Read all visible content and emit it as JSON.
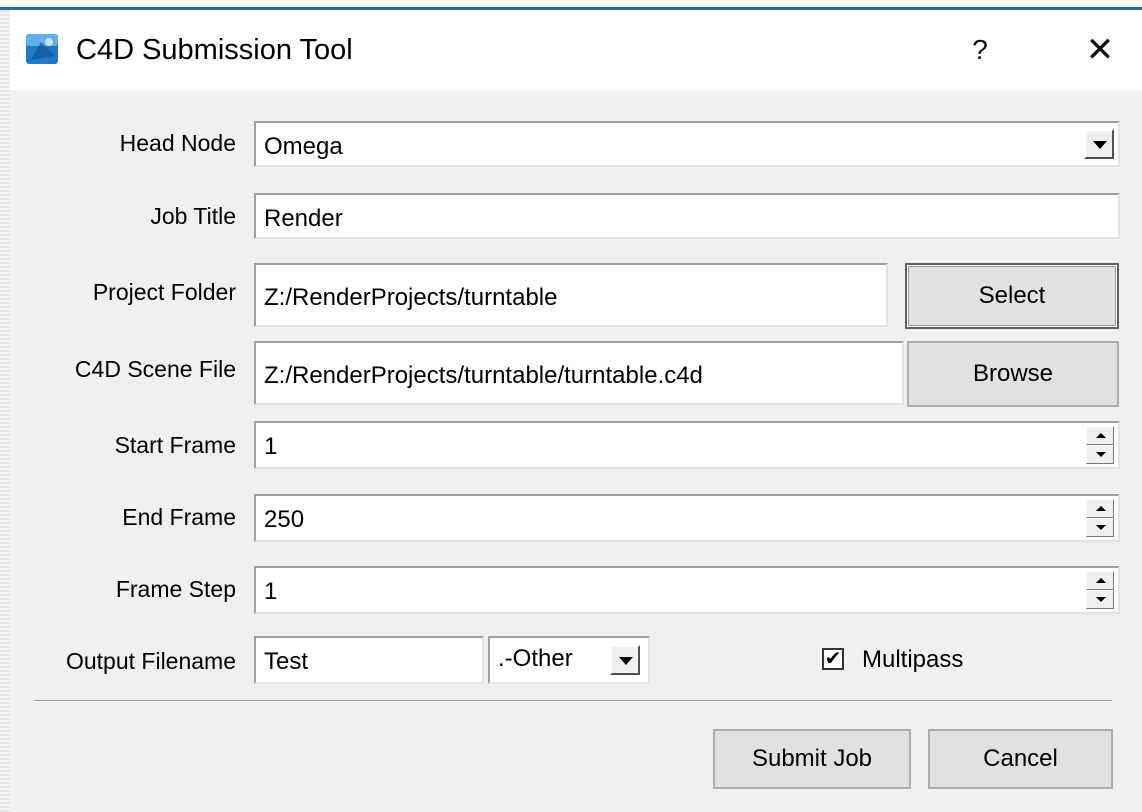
{
  "window": {
    "title": "C4D Submission Tool",
    "help_label": "?",
    "close_label": "✕"
  },
  "form": {
    "head_node": {
      "label": "Head Node",
      "value": "Omega"
    },
    "job_title": {
      "label": "Job Title",
      "value": "Render"
    },
    "project_folder": {
      "label": "Project Folder",
      "value": "Z:/RenderProjects/turntable",
      "button": "Select"
    },
    "scene_file": {
      "label": "C4D Scene File",
      "value": "Z:/RenderProjects/turntable/turntable.c4d",
      "button": "Browse"
    },
    "start_frame": {
      "label": "Start Frame",
      "value": "1"
    },
    "end_frame": {
      "label": "End Frame",
      "value": "250"
    },
    "frame_step": {
      "label": "Frame Step",
      "value": "1"
    },
    "output": {
      "label": "Output Filename",
      "value": "Test",
      "format": ".-Other"
    },
    "multipass": {
      "label": "Multipass",
      "checked": true,
      "check_glyph": "✔"
    }
  },
  "actions": {
    "submit": "Submit Job",
    "cancel": "Cancel"
  },
  "colors": {
    "accent": "#2b6dad",
    "dialog_bg": "#f0f0f0",
    "button_bg": "#e1e1e1"
  },
  "icons": {
    "app": "c4d-app-icon",
    "help": "question-mark-icon",
    "close": "close-icon",
    "dropdown": "chevron-down-icon",
    "spin": "spinner-arrows-icon",
    "check": "checkmark-icon"
  }
}
